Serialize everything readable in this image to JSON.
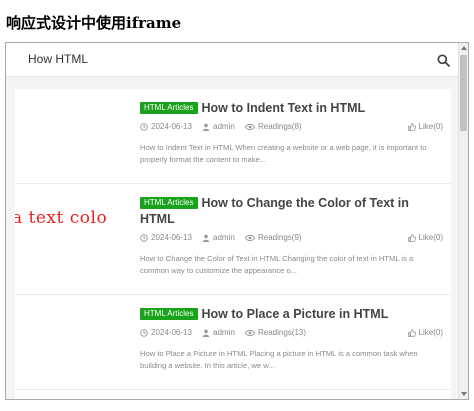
{
  "page": {
    "heading": "响应式设计中使用iframe"
  },
  "site": {
    "title": "How HTML",
    "search_icon": "search-icon"
  },
  "articles": [
    {
      "tag": "HTML Articles",
      "title": "How to Indent Text in HTML",
      "date": "2024-06-13",
      "author": "admin",
      "readings": "Readings(8)",
      "likes": "Like(0)",
      "excerpt": "How to Indent Text in HTML When creating a website or a web page, it is important to properly format the content to make...",
      "thumbnail_text": ""
    },
    {
      "tag": "HTML Articles",
      "title": "How to Change the Color of Text in HTML",
      "date": "2024-06-13",
      "author": "admin",
      "readings": "Readings(9)",
      "likes": "Like(0)",
      "excerpt": "How to Change the Color of Text in HTML Changing the color of text in HTML is a common way to customize the appearance o...",
      "thumbnail_text": "a text colo"
    },
    {
      "tag": "HTML Articles",
      "title": "How to Place a Picture in HTML",
      "date": "2024-06-13",
      "author": "admin",
      "readings": "Readings(13)",
      "likes": "Like(0)",
      "excerpt": "How to Place a Picture in HTML Placing a picture in HTML is a common task when building a website. In this article, we w...",
      "thumbnail_text": ""
    }
  ],
  "colors": {
    "tag_bg": "#1aa31a",
    "thumbnail_text": "#e8221e"
  }
}
